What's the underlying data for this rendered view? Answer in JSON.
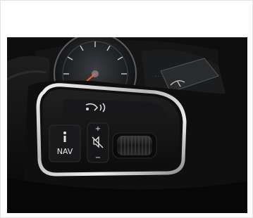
{
  "photo": {
    "subject_icons": [
      "voice-command-icon",
      "info-icon",
      "mute-icon",
      "scroll-wheel-icon"
    ],
    "button_labels": {
      "nav": "NAV",
      "plus": "+",
      "minus": "−"
    }
  }
}
